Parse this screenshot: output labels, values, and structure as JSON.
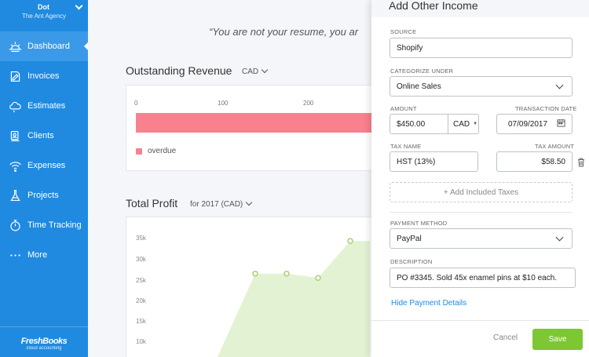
{
  "account": {
    "name": "Dot",
    "org": "The Ant Agency"
  },
  "nav": {
    "items": [
      {
        "label": "Dashboard",
        "icon": "sun-icon"
      },
      {
        "label": "Invoices",
        "icon": "invoice-icon"
      },
      {
        "label": "Estimates",
        "icon": "cloud-icon"
      },
      {
        "label": "Clients",
        "icon": "clients-icon"
      },
      {
        "label": "Expenses",
        "icon": "wifi-icon"
      },
      {
        "label": "Projects",
        "icon": "flask-icon"
      },
      {
        "label": "Time Tracking",
        "icon": "stopwatch-icon"
      },
      {
        "label": "More",
        "icon": "dots-icon"
      }
    ]
  },
  "brand": {
    "name": "FreshBooks",
    "tagline": "cloud accounting"
  },
  "quote": "“You are not your resume, you ar",
  "outstanding": {
    "title": "Outstanding Revenue",
    "currency": "CAD",
    "ticks": [
      "0",
      "100",
      "200"
    ],
    "legend": "overdue"
  },
  "profit": {
    "title": "Total Profit",
    "period": "for 2017 (CAD)",
    "ylabels": [
      "35k",
      "30k",
      "25k",
      "20k",
      "15k",
      "10k"
    ]
  },
  "chart_data": [
    {
      "type": "bar",
      "title": "Outstanding Revenue",
      "x_ticks": [
        0,
        100,
        200
      ],
      "series": [
        {
          "name": "overdue",
          "values": [
            280
          ]
        }
      ],
      "colors": {
        "overdue": "#f9808e"
      }
    },
    {
      "type": "area",
      "title": "Total Profit",
      "y_ticks": [
        "35k",
        "30k",
        "25k",
        "20k",
        "15k",
        "10k"
      ],
      "ylim": [
        5000,
        37500
      ],
      "series": [
        {
          "values": [
            26000,
            26000,
            25000,
            33500,
            33500
          ]
        }
      ],
      "colors": {
        "line": "#a6d270",
        "fill": "#e4f2d4"
      }
    }
  ],
  "panel": {
    "title": "Add Other Income",
    "source": {
      "label": "SOURCE",
      "value": "Shopify"
    },
    "category": {
      "label": "CATEGORIZE UNDER",
      "value": "Online Sales"
    },
    "amount": {
      "label": "AMOUNT",
      "value": "$450.00",
      "currency": "CAD"
    },
    "date": {
      "label": "TRANSACTION DATE",
      "value": "07/09/2017"
    },
    "tax_name": {
      "label": "TAX NAME",
      "value": "HST (13%)"
    },
    "tax_amount": {
      "label": "TAX AMOUNT",
      "value": "$58.50"
    },
    "add_taxes": "+ Add Included Taxes",
    "payment": {
      "label": "PAYMENT METHOD",
      "value": "PayPal"
    },
    "description": {
      "label": "DESCRIPTION",
      "value": "PO #3345. Sold 45x enamel pins at $10 each."
    },
    "hide_link": "Hide Payment Details",
    "cancel": "Cancel",
    "save": "Save"
  },
  "colors": {
    "sidebar": "#1f8ae0",
    "save": "#7dc733",
    "link": "#1f8ae0"
  }
}
